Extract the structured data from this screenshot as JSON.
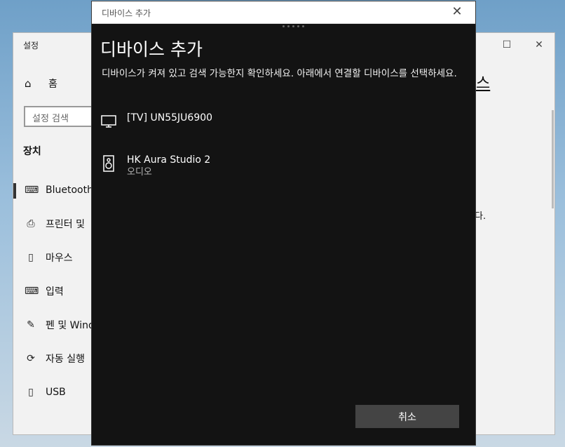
{
  "settings": {
    "window_title": "설정",
    "home_label": "홈",
    "search_placeholder": "설정 검색",
    "section_title": "장치",
    "nav": [
      {
        "label": "Bluetooth",
        "icon": "bluetooth-device-icon",
        "active": true
      },
      {
        "label": "프린터 및",
        "icon": "printer-icon"
      },
      {
        "label": "마우스",
        "icon": "mouse-icon"
      },
      {
        "label": "입력",
        "icon": "keyboard-icon"
      },
      {
        "label": "펜 및 Wind",
        "icon": "pen-icon"
      },
      {
        "label": "자동 실행",
        "icon": "autoplay-icon"
      },
      {
        "label": "USB",
        "icon": "usb-icon"
      }
    ],
    "right_fragment_heading": "스",
    "right_fragment_text": "다."
  },
  "dialog": {
    "window_title": "디바이스 추가",
    "heading": "디바이스 추가",
    "description": "디바이스가 켜져 있고 검색 가능한지 확인하세요. 아래에서 연결할 디바이스를 선택하세요.",
    "devices": [
      {
        "name": "[TV] UN55JU6900",
        "type": "",
        "icon": "tv-icon"
      },
      {
        "name": "HK Aura Studio 2",
        "type": "오디오",
        "icon": "speaker-icon"
      }
    ],
    "cancel_label": "취소"
  }
}
